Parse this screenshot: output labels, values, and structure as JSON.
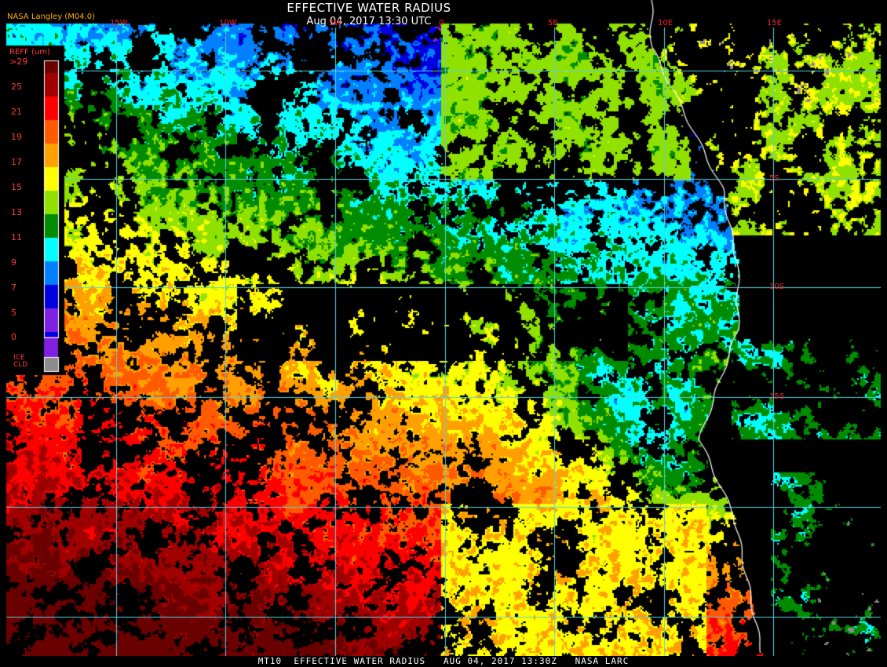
{
  "header": {
    "title": "EFFECTIVE WATER RADIUS",
    "subtitle": "Aug 04, 2017 13:30 UTC",
    "credit": "NASA Langley (M04.0)"
  },
  "legend": {
    "unit": "REFF (um)",
    "labels": [
      ">29",
      "25",
      "21",
      "19",
      "17",
      "15",
      "13",
      "11",
      "9",
      "7",
      "5",
      "0"
    ],
    "colors": [
      "#6b0000",
      "#a00000",
      "#ff0000",
      "#ff5a00",
      "#ffa000",
      "#ffff00",
      "#90e000",
      "#008c00",
      "#00ffff",
      "#0080ff",
      "#0000e0",
      "#8020e0"
    ],
    "ice_label": "ICE\nCLD",
    "ice_color": "#8c8c8c"
  },
  "grid": {
    "longitude_labels": [
      "15W",
      "10W",
      "5W",
      "0",
      "5E",
      "10E",
      "15E"
    ],
    "latitude_labels": [
      "5S",
      "10S",
      "15S"
    ]
  },
  "footer": {
    "text": "MT10  EFFECTIVE WATER RADIUS   AUG 04, 2017 13:30Z   NASA LARC"
  }
}
